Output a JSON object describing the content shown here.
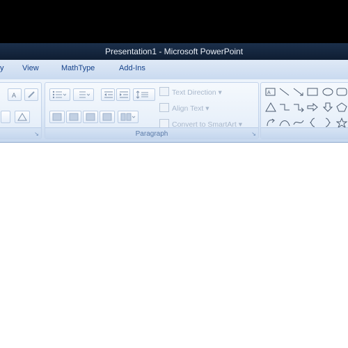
{
  "window": {
    "title": "Presentation1 - Microsoft PowerPoint"
  },
  "tabs": [
    {
      "label": "View"
    },
    {
      "label": "MathType"
    },
    {
      "label": "Add-Ins"
    }
  ],
  "ribbon": {
    "paragraph_group": {
      "label": "Paragraph"
    },
    "commands": {
      "text_direction": "Text Direction",
      "align_text": "Align Text",
      "convert_smartart": "Convert to SmartArt"
    }
  },
  "icons": {
    "colors": {
      "accent": "#15428b",
      "ribbon": "#dce8f6",
      "titlebar": "#0f1e33"
    }
  }
}
